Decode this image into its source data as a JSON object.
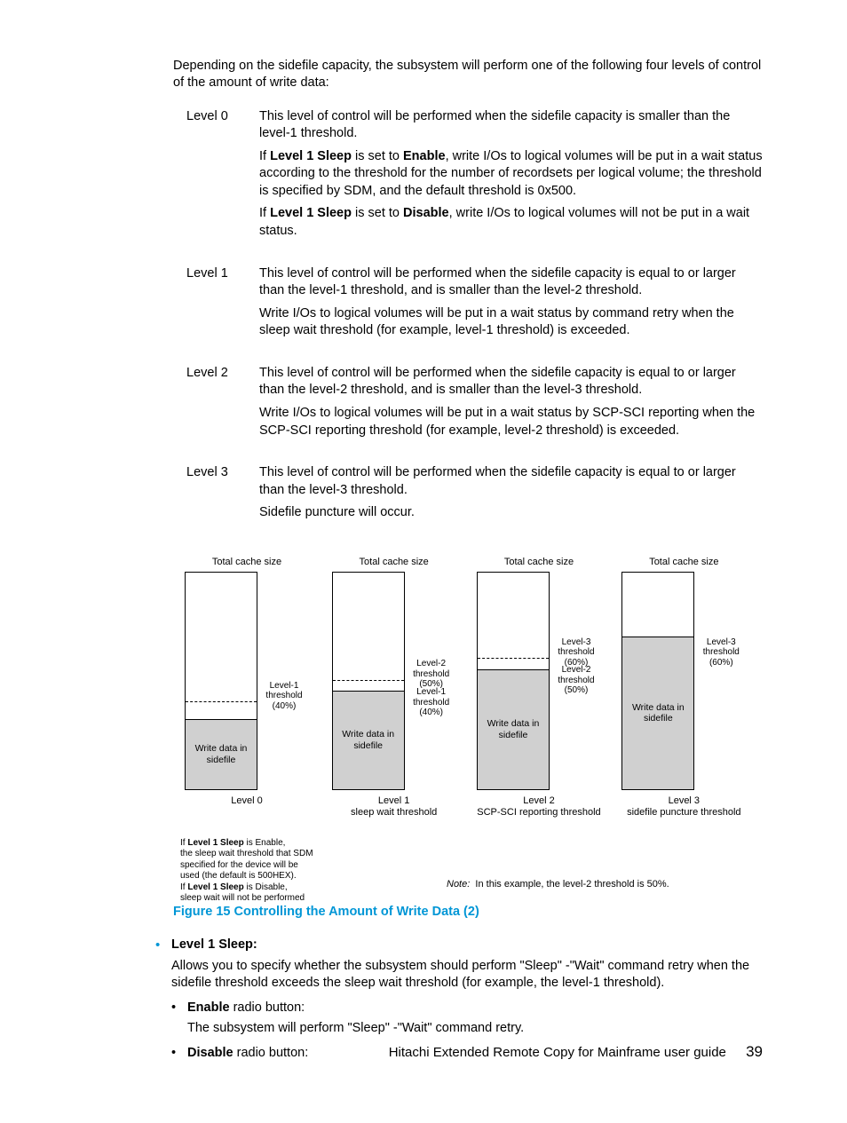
{
  "intro": "Depending on the sidefile capacity, the subsystem will perform one of the following four levels of control of the amount of write data:",
  "levels": [
    {
      "label": "Level 0",
      "paras": [
        {
          "plain": "This level of control will be performed when the sidefile capacity is smaller than the level-1 threshold."
        },
        {
          "rich": [
            "If ",
            [
              "b",
              "Level 1 Sleep"
            ],
            " is set to ",
            [
              "b",
              "Enable"
            ],
            ", write I/Os to logical volumes will be put in a wait status according to the threshold for the number of recordsets per logical volume; the threshold is specified by SDM, and the default threshold is 0x500."
          ]
        },
        {
          "rich": [
            "If ",
            [
              "b",
              "Level 1 Sleep"
            ],
            " is set to ",
            [
              "b",
              "Disable"
            ],
            ", write I/Os to logical volumes will not be put in a wait status."
          ]
        }
      ]
    },
    {
      "label": "Level 1",
      "paras": [
        {
          "plain": "This level of control will be performed when the sidefile capacity is equal to or larger than the level-1 threshold, and is smaller than the level-2 threshold."
        },
        {
          "plain": "Write I/Os to logical volumes will be put in a wait status by command retry when the sleep wait threshold (for example, level-1 threshold) is exceeded."
        }
      ]
    },
    {
      "label": "Level 2",
      "paras": [
        {
          "plain": "This level of control will be performed when the sidefile capacity is equal to or larger than the level-2 threshold, and is smaller than the level-3 threshold."
        },
        {
          "plain": "Write I/Os to logical volumes will be put in a wait status by SCP-SCI reporting when the SCP-SCI reporting threshold (for example, level-2 threshold) is exceeded."
        }
      ]
    },
    {
      "label": "Level 3",
      "paras": [
        {
          "plain": "This level of control will be performed when the sidefile capacity is equal to or larger than the level-3 threshold."
        },
        {
          "plain": "Sidefile puncture will occur."
        }
      ]
    }
  ],
  "diagram": {
    "top": "Total cache size",
    "write": "Write data in sidefile",
    "thresholds": {
      "l1": "Level-1 threshold (40%)",
      "l2": "Level-2 threshold (50%)",
      "l3": "Level-3 threshold (60%)"
    },
    "cols": [
      {
        "name": "Level 0",
        "sub": "",
        "fill_pct": 32
      },
      {
        "name": "Level 1",
        "sub": "sleep wait threshold",
        "fill_pct": 45
      },
      {
        "name": "Level 2",
        "sub": "SCP-SCI reporting threshold",
        "fill_pct": 55
      },
      {
        "name": "Level 3",
        "sub": "sidefile puncture threshold",
        "fill_pct": 70
      }
    ],
    "foot0": {
      "l1a": "If ",
      "l1b": "Level 1 Sleep",
      "l1c": " is Enable,",
      "l2": "the sleep wait threshold that SDM specified for the device will be used (the default is 500HEX).",
      "l3a": "If ",
      "l3b": "Level 1 Sleep",
      "l3c": " is Disable,",
      "l4": "sleep wait will not be performed"
    },
    "note_label": "Note:",
    "note_text": "In this example, the level-2 threshold is 50%."
  },
  "figcaption": "Figure 15 Controlling the Amount of Write Data (2)",
  "l1sleep": {
    "title": "Level 1 Sleep:",
    "desc": "Allows you to specify whether the subsystem should perform \"Sleep\" -\"Wait\" command retry when the sidefile threshold exceeds the sleep wait threshold (for example, the level-1 threshold).",
    "enable_b": "Enable",
    "enable_rest": " radio button:",
    "enable_desc": "The subsystem will perform \"Sleep\" -\"Wait\" command retry.",
    "disable_b": "Disable",
    "disable_rest": " radio button:"
  },
  "footer": {
    "title": "Hitachi Extended Remote Copy for Mainframe user guide",
    "page": "39"
  }
}
